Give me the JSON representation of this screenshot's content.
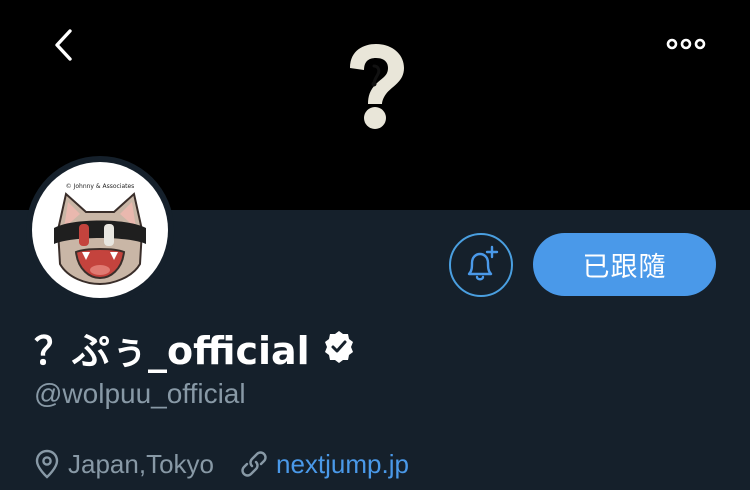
{
  "profile": {
    "display_name": "？ぷぅ_official",
    "handle": "@wolpuu_official",
    "location": "Japan,Tokyo",
    "website": "nextjump.jp",
    "verified": true,
    "avatar_caption": "© Johnny & Associates"
  },
  "actions": {
    "follow_label": "已跟隨"
  },
  "icons": {
    "back": "chevron-left-icon",
    "more": "more-horizontal-icon",
    "notifications": "bell-plus-icon",
    "location": "map-pin-icon",
    "link": "link-icon",
    "verified": "verified-badge-icon"
  },
  "colors": {
    "background": "#15202b",
    "banner": "#000000",
    "accent": "#4a99e9",
    "secondary_text": "#8899a6",
    "primary_text": "#ffffff"
  }
}
